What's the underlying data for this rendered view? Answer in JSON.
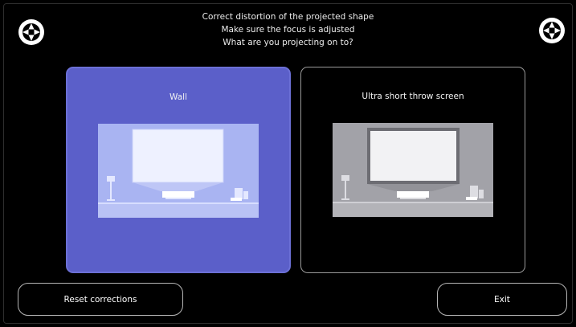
{
  "instructions": {
    "line1": "Correct distortion of the projected shape",
    "line2": "Make sure the focus is adjusted",
    "line3": "What are you projecting on to?"
  },
  "corner_markers": {
    "left_icon": "alignment-target-icon",
    "right_icon": "alignment-target-icon"
  },
  "options": [
    {
      "label": "Wall",
      "selected": true,
      "illustration_icon": "wall-projection-illustration",
      "colors": {
        "card": "#5b5fc9",
        "illustration_bg": "#a9b4f2",
        "screen": "#eef1ff"
      }
    },
    {
      "label": "Ultra short throw screen",
      "selected": false,
      "illustration_icon": "ust-screen-illustration",
      "colors": {
        "card": "#000000",
        "illustration_bg": "#a2a2a8",
        "screen": "#f2f2f4"
      }
    }
  ],
  "buttons": {
    "reset_label": "Reset corrections",
    "exit_label": "Exit"
  }
}
